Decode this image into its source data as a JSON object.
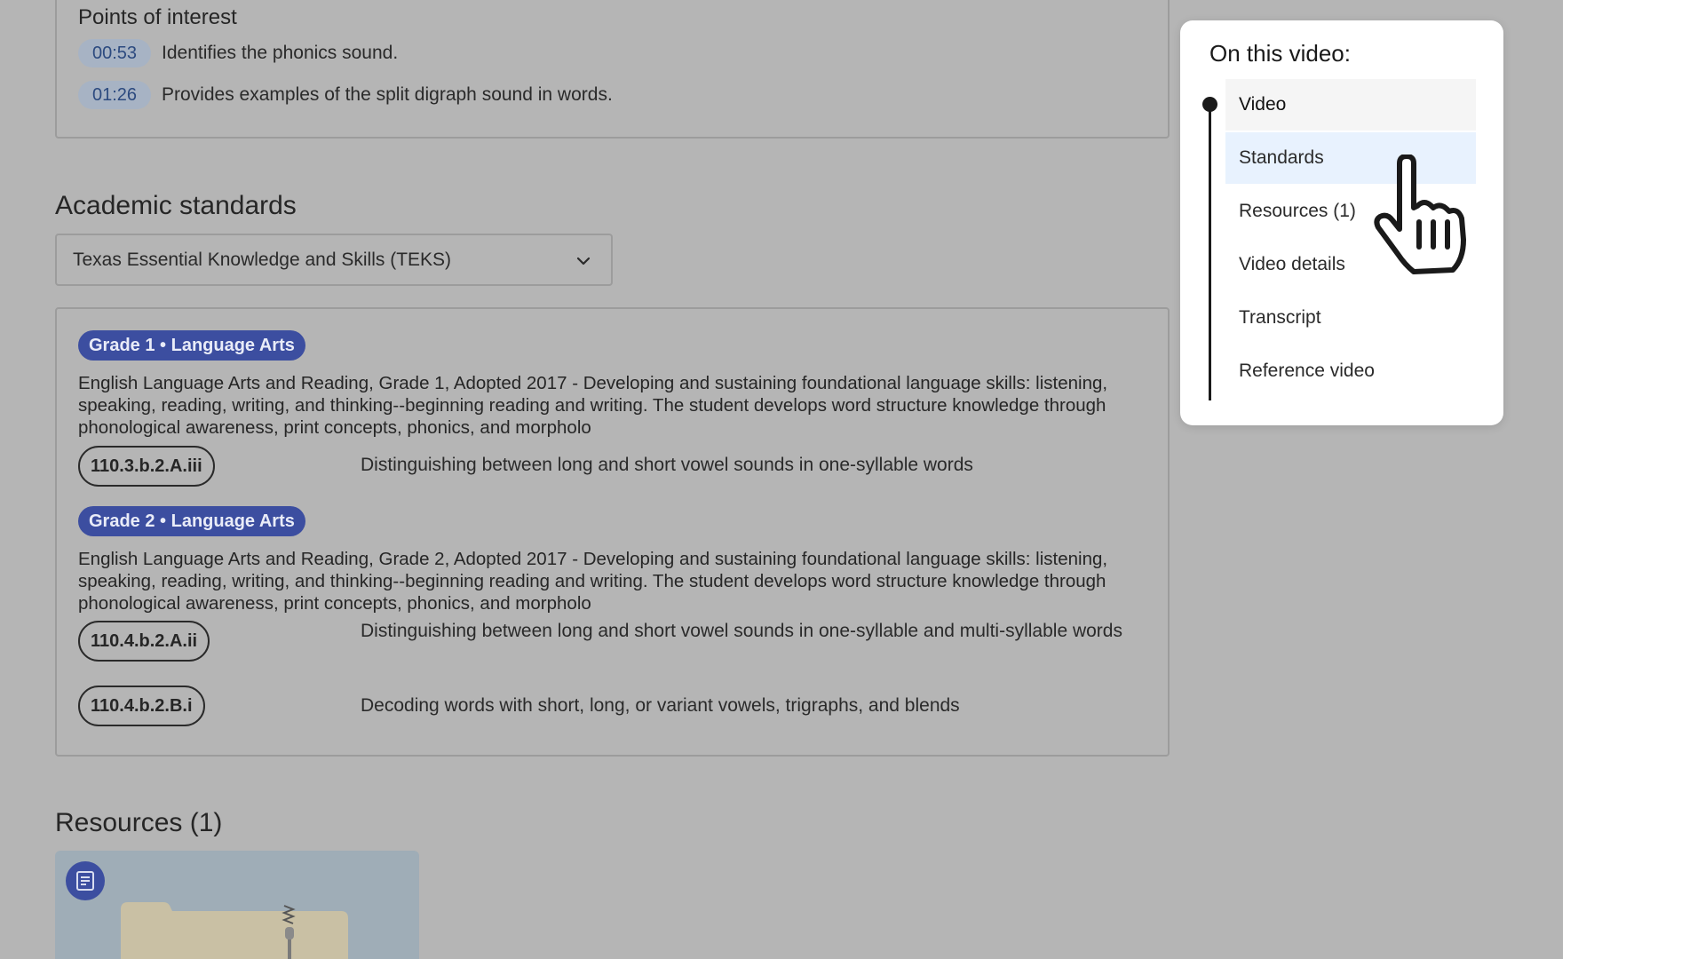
{
  "points_of_interest": {
    "title": "Points of interest",
    "items": [
      {
        "time": "00:53",
        "description": "Identifies the phonics sound."
      },
      {
        "time": "01:26",
        "description": "Provides examples of the split digraph sound in words."
      }
    ]
  },
  "academic_standards": {
    "title": "Academic standards",
    "selected_standard": "Texas Essential Knowledge and Skills (TEKS)",
    "groups": [
      {
        "badge": "Grade 1 • Language Arts",
        "description": "English Language Arts and Reading, Grade 1, Adopted 2017 - Developing and sustaining foundational language skills: listening, speaking, reading, writing, and thinking--beginning reading and writing. The student develops word structure knowledge through phonological awareness, print concepts, phonics, and morpholo",
        "standards": [
          {
            "code": "110.3.b.2.A.iii",
            "description": "Distinguishing between long and short vowel sounds in one-syllable words"
          }
        ]
      },
      {
        "badge": "Grade 2 • Language Arts",
        "description": "English Language Arts and Reading, Grade 2, Adopted 2017 - Developing and sustaining foundational language skills: listening, speaking, reading, writing, and thinking--beginning reading and writing. The student develops word structure knowledge through phonological awareness, print concepts, phonics, and morpholo",
        "standards": [
          {
            "code": "110.4.b.2.A.ii",
            "description": "Distinguishing between long and short vowel sounds in one-syllable and multi-syllable words"
          },
          {
            "code": "110.4.b.2.B.i",
            "description": "Decoding words with short, long, or variant vowels, trigraphs, and blends"
          }
        ]
      }
    ]
  },
  "resources": {
    "title": "Resources (1)",
    "card_icon": "document-icon"
  },
  "toc": {
    "title": "On this video:",
    "items": [
      {
        "label": "Video",
        "state": "current"
      },
      {
        "label": "Standards",
        "state": "hover"
      },
      {
        "label": "Resources (1)",
        "state": ""
      },
      {
        "label": "Video details",
        "state": ""
      },
      {
        "label": "Transcript",
        "state": ""
      },
      {
        "label": "Reference video",
        "state": ""
      }
    ]
  },
  "colors": {
    "overlay": "#b5b5b5",
    "badge": "#3c4ea0",
    "hover": "#e8f2fe"
  }
}
